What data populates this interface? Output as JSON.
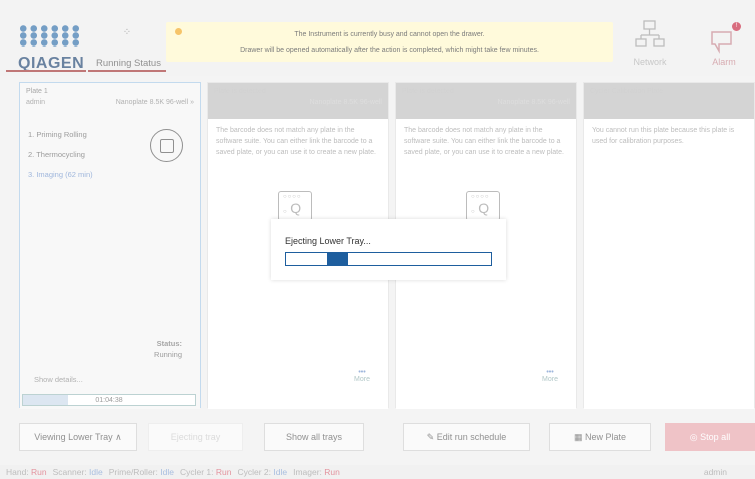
{
  "header": {
    "logo_text": "QIAGEN",
    "running_status_label": "Running Status",
    "network_label": "Network",
    "alarm_label": "Alarm",
    "alarm_badge": "!"
  },
  "banner": {
    "line1": "The Instrument is currently busy and cannot open the drawer.",
    "line2": "Drawer will be opened automatically after the action is completed, which might take few minutes.",
    "dot_color": "#f2a51a"
  },
  "col1": {
    "title": "Plate 1",
    "user": "admin",
    "plate_type": "Nanoplate 8.5K 96-well",
    "steps": [
      "1. Priming Rolling",
      "2. Thermocycling",
      "3. Imaging (62 min)"
    ],
    "status_label": "Status:",
    "status_value": "Running",
    "show_details": "Show details...",
    "timer": "01:04:38",
    "timer_progress": 0.26
  },
  "col2": {
    "title": "Plate is detected",
    "plate_type": "Nanoplate 8.5K 96-well",
    "message": "The barcode does not match any plate in the software suite. You can either link the barcode to a saved plate, or you can use it to create a new plate.",
    "more": "More"
  },
  "col3": {
    "title": "Plate is detected",
    "plate_type": "Nanoplate 8.5K 96-well",
    "message": "The barcode does not match any plate in the software suite. You can either link the barcode to a saved plate, or you can use it to create a new plate.",
    "more": "More"
  },
  "col4": {
    "title": "Cycler Calibration Plate",
    "message": "You cannot run this plate because this plate is used for calibration purposes."
  },
  "dialog": {
    "title": "Ejecting Lower Tray...",
    "progress_start": 0.2,
    "progress_end": 0.3
  },
  "footer": {
    "viewing": "Viewing Lower Tray",
    "eject": "Ejecting tray",
    "show_all": "Show all trays",
    "edit": "Edit run schedule",
    "new_plate": "New Plate",
    "stop_all": "Stop all"
  },
  "statusbar": {
    "items": [
      {
        "label": "Hand:",
        "value": "Run",
        "state": "run"
      },
      {
        "label": "Scanner:",
        "value": "Idle",
        "state": "idle"
      },
      {
        "label": "Prime/Roller:",
        "value": "Idle",
        "state": "idle"
      },
      {
        "label": "Cycler 1:",
        "value": "Run",
        "state": "run"
      },
      {
        "label": "Cycler 2:",
        "value": "Idle",
        "state": "idle"
      },
      {
        "label": "Imager:",
        "value": "Run",
        "state": "run"
      }
    ],
    "user": "admin"
  }
}
